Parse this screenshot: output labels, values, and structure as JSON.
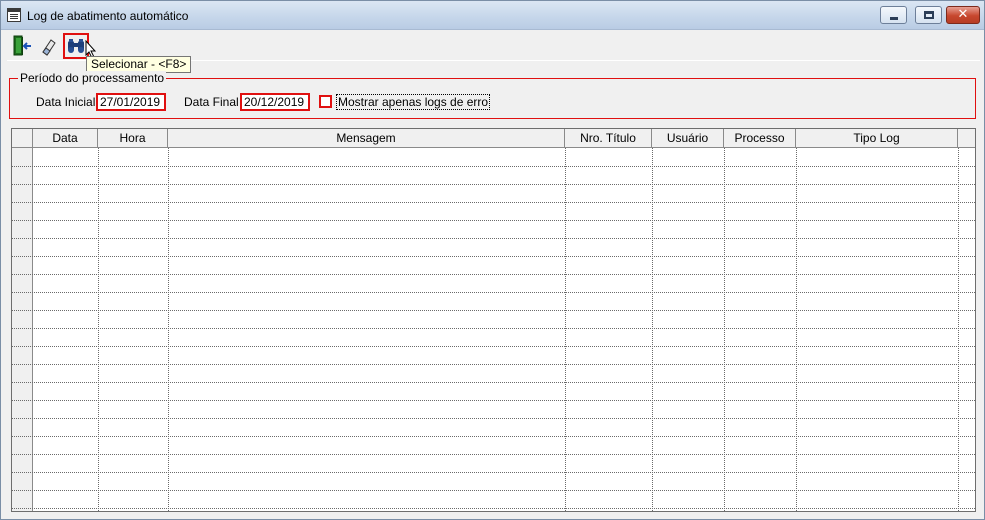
{
  "window": {
    "title": "Log de abatimento automático",
    "icon": "app-window-icon",
    "controls": {
      "minimize": "minimize-icon",
      "maximize": "maximize-icon",
      "close": "close-icon",
      "close_glyph": "✕"
    }
  },
  "toolbar": {
    "buttons": [
      {
        "name": "exit",
        "icon": "exit-door-icon"
      },
      {
        "name": "clear",
        "icon": "eraser-icon"
      },
      {
        "name": "select",
        "icon": "binoculars-icon"
      }
    ],
    "tooltip": "Selecionar - <F8>"
  },
  "period": {
    "legend": "Período do processamento",
    "start_label": "Data Inicial",
    "start_value": "27/01/2019",
    "end_label": "Data Final",
    "end_value": "20/12/2019",
    "errors_only_label": "Mostrar apenas logs de erro",
    "errors_only_checked": false
  },
  "grid": {
    "columns": [
      "",
      "Data",
      "Hora",
      "Mensagem",
      "Nro. Título",
      "Usuário",
      "Processo",
      "Tipo Log",
      ""
    ],
    "rows": []
  },
  "colors": {
    "highlight": "#e01010",
    "tooltip_bg": "#ffffe1",
    "window_bg": "#f0f0f0"
  }
}
